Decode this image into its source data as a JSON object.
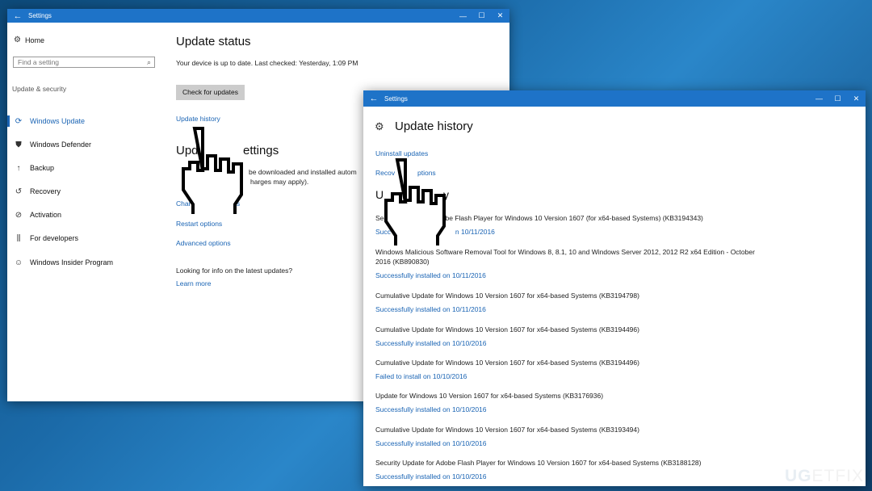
{
  "window1": {
    "title": "Settings",
    "controls": [
      "—",
      "☐",
      "✕"
    ],
    "sidebar": {
      "home": "Home",
      "search_placeholder": "Find a setting",
      "section": "Update & security",
      "items": [
        {
          "label": "Windows Update",
          "icon": "refresh-icon",
          "active": true
        },
        {
          "label": "Windows Defender",
          "icon": "shield-icon"
        },
        {
          "label": "Backup",
          "icon": "backup-arrow-icon"
        },
        {
          "label": "Recovery",
          "icon": "recovery-icon"
        },
        {
          "label": "Activation",
          "icon": "check-circle-icon"
        },
        {
          "label": "For developers",
          "icon": "developer-icon"
        },
        {
          "label": "Windows Insider Program",
          "icon": "insider-icon"
        }
      ]
    },
    "main": {
      "title": "Update status",
      "status_text": "Your device is up to date. Last checked: Yesterday, 1:09 PM",
      "check_button": "Check for updates",
      "history_link": "Update history",
      "settings_heading_part": "Upd",
      "settings_heading_end": "ettings",
      "settings_desc_1": "be downloaded and installed autom",
      "settings_desc_2": "harges may apply).",
      "change_link_start": "Chang",
      "change_link_end": "rs",
      "restart_link": "Restart options",
      "advanced_link": "Advanced options",
      "info_text": "Looking for info on the latest updates?",
      "learn_link": "Learn more"
    }
  },
  "window2": {
    "title": "Settings",
    "controls": [
      "—",
      "☐",
      "✕"
    ],
    "heading": "Update history",
    "uninstall_link": "Uninstall updates",
    "recovery_link_start": "Recov",
    "recovery_link_end": "ptions",
    "section_heading_start": "U",
    "section_heading_end": "y",
    "items": [
      {
        "title_start": "Secu",
        "title_end": "Adobe Flash Player for Windows 10 Version 1607 (for x64-based Systems) (KB3194343)",
        "status_start": "Succ",
        "status_end": "n 10/11/2016"
      },
      {
        "title": "Windows Malicious Software Removal Tool for Windows 8, 8.1, 10 and Windows Server 2012, 2012 R2 x64 Edition - October 2016 (KB890830)",
        "status": "Successfully installed on 10/11/2016"
      },
      {
        "title": "Cumulative Update for Windows 10 Version 1607 for x64-based Systems (KB3194798)",
        "status": "Successfully installed on 10/11/2016"
      },
      {
        "title": "Cumulative Update for Windows 10 Version 1607 for x64-based Systems (KB3194496)",
        "status": "Successfully installed on 10/10/2016"
      },
      {
        "title": "Cumulative Update for Windows 10 Version 1607 for x64-based Systems (KB3194496)",
        "status": "Failed to install on 10/10/2016"
      },
      {
        "title": "Update for Windows 10 Version 1607 for x64-based Systems (KB3176936)",
        "status": "Successfully installed on 10/10/2016"
      },
      {
        "title": "Cumulative Update for Windows 10 Version 1607 for x64-based Systems (KB3193494)",
        "status": "Successfully installed on 10/10/2016"
      },
      {
        "title": "Security Update for Adobe Flash Player for Windows 10 Version 1607 for x64-based Systems (KB3188128)",
        "status": "Successfully installed on 10/10/2016"
      }
    ]
  },
  "watermark": {
    "part1": "UG",
    "part2": "ETFIX"
  },
  "colors": {
    "accent": "#1e73c8",
    "link": "#1a64b4",
    "desktop": "#1b6aa8"
  }
}
